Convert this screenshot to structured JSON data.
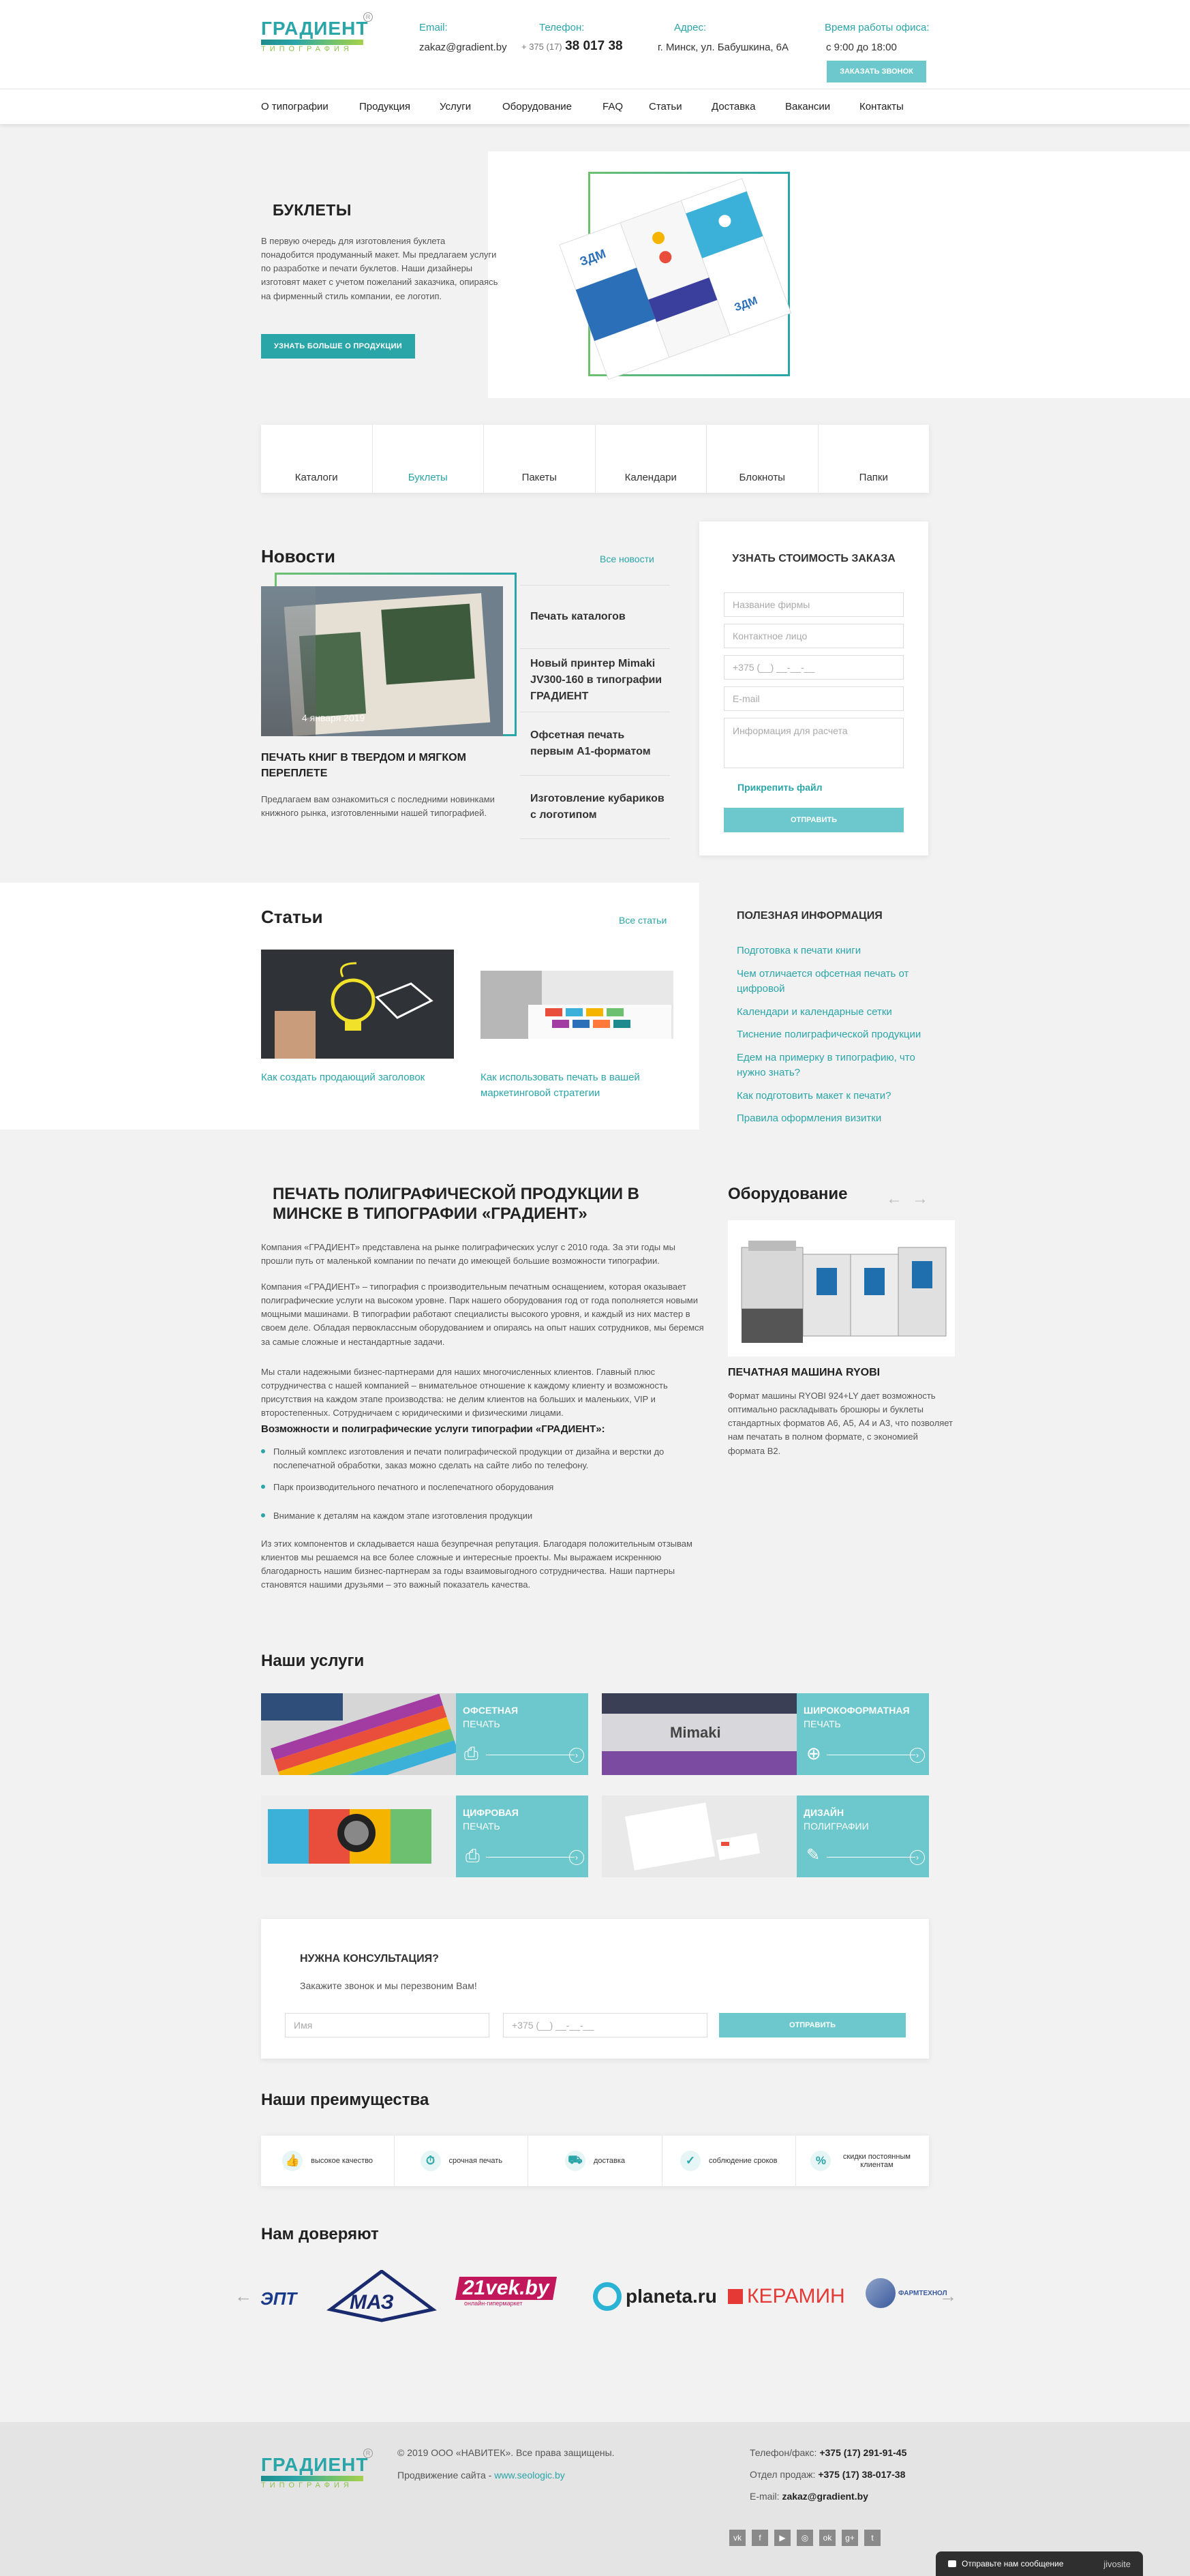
{
  "header": {
    "logo_text": "ГРАДИЕНТ",
    "logo_sub": "ТИПОГРАФИЯ",
    "email_label": "Email:",
    "email": "zakaz@gradient.by",
    "phone_label": "Телефон:",
    "phone_prefix": "+ 375 (17)",
    "phone_number": "38 017 38",
    "address_label": "Адрес:",
    "address": "г. Минск, ул. Бабушкина, 6А",
    "hours_label": "Время работы офиса:",
    "hours": "с 9:00 до 18:00",
    "callback_button": "ЗАКАЗАТЬ ЗВОНОК"
  },
  "nav": {
    "items": [
      "О типографии",
      "Продукция",
      "Услуги",
      "Оборудование",
      "FAQ",
      "Статьи",
      "Доставка",
      "Вакансии",
      "Контакты"
    ]
  },
  "hero": {
    "title": "БУКЛЕТЫ",
    "text": "В первую очередь для изготовления буклета понадобится продуманный макет. Мы предлагаем услуги по разработке и печати буклетов. Наши дизайнеры изготовят макет с учетом пожеланий заказчика, опираясь на фирменный стиль компании, ее логотип.",
    "button": "УЗНАТЬ БОЛЬШЕ О ПРОДУКЦИИ"
  },
  "product_tabs": [
    "Каталоги",
    "Буклеты",
    "Пакеты",
    "Календари",
    "Блокноты",
    "Папки"
  ],
  "product_tab_active": "Буклеты",
  "news": {
    "title": "Новости",
    "all_link": "Все новости",
    "featured_date": "4 января 2019",
    "featured_title": "ПЕЧАТЬ КНИГ В ТВЕРДОМ И МЯГКОМ ПЕРЕПЛЕТЕ",
    "featured_text": "Предлагаем вам ознакомиться с последними новинками книжного рынка, изготовленными нашей типографией.",
    "items": [
      "Печать каталогов",
      "Новый принтер Mimaki JV300-160 в типографии ГРАДИЕНТ",
      "Офсетная печать первым А1-форматом",
      "Изготовление кубариков с логотипом"
    ]
  },
  "quote_form": {
    "title": "УЗНАТЬ СТОИМОСТЬ ЗАКАЗА",
    "company_placeholder": "Название фирмы",
    "contact_placeholder": "Контактное лицо",
    "phone_placeholder": "+375 (__) __-__-__",
    "email_placeholder": "E-mail",
    "info_placeholder": "Информация для расчета",
    "attach_label": "Прикрепить файл",
    "submit": "ОТПРАВИТЬ"
  },
  "articles": {
    "title": "Статьи",
    "all_link": "Все статьи",
    "items": [
      "Как создать продающий заголовок",
      "Как использовать печать в вашей маркетинговой стратегии"
    ]
  },
  "useful_info": {
    "title": "ПОЛЕЗНАЯ ИНФОРМАЦИЯ",
    "links": [
      "Подготовка к печати книги",
      "Чем отличается офсетная печать от цифровой",
      "Календари и календарные сетки",
      "Тиснение полиграфической продукции",
      "Едем на примерку в типографию, что нужно знать?",
      "Как подготовить макет к печати?",
      "Правила оформления визитки"
    ]
  },
  "about": {
    "title": "ПЕЧАТЬ ПОЛИГРАФИЧЕСКОЙ ПРОДУКЦИИ В МИНСКЕ В ТИПОГРАФИИ «ГРАДИЕНТ»",
    "p1": "Компания «ГРАДИЕНТ» представлена на рынке полиграфических услуг с 2010 года. За эти годы мы прошли путь от маленькой компании по печати до имеющей большие возможности типографии.",
    "p2": "Компания «ГРАДИЕНТ» – типография с производительным печатным оснащением, которая оказывает полиграфические услуги на высоком уровне. Парк нашего оборудования год от года пополняется новыми мощными машинами. В типографии работают специалисты высокого уровня, и каждый из них мастер в своем деле. Обладая первоклассным оборудованием и опираясь на опыт наших сотрудников, мы беремся за самые сложные и нестандартные задачи.",
    "p3": "Мы стали надежными бизнес-партнерами для наших многочисленных клиентов. Главный плюс сотрудничества с нашей компанией – внимательное отношение к каждому клиенту и возможность присутствия на каждом этапе производства: не делим клиентов на больших и маленьких, VIP и второстепенных. Сотрудничаем с юридическими и физическими лицами.",
    "subtitle": "Возможности и полиграфические услуги типографии «ГРАДИЕНТ»:",
    "bullets": [
      "Полный комплекс изготовления и печати полиграфической продукции от дизайна и верстки до послепечатной обработки, заказ можно сделать на сайте либо по телефону.",
      "Парк производительного печатного и послепечатного оборудования",
      "Внимание к деталям на каждом этапе изготовления продукции"
    ],
    "p4": "Из этих компонентов и складывается наша безупречная репутация. Благодаря положительным отзывам клиентов мы решаемся на все более сложные и интересные проекты. Мы выражаем искреннюю благодарность нашим бизнес-партнерам за годы взаимовыгодного сотрудничества. Наши партнеры становятся нашими друзьями – это важный показатель качества."
  },
  "equipment": {
    "title": "Оборудование",
    "machine_title": "ПЕЧАТНАЯ МАШИНА RYOBI",
    "machine_text": "Формат машины RYOBI 924+LY дает возможность оптимально раскладывать брошюры и буклеты стандартных форматов А6, А5, А4 и А3, что позволяет нам печатать в полном формате, с экономией формата В2."
  },
  "services": {
    "title": "Наши услуги",
    "items": [
      {
        "line1": "ОФСЕТНАЯ",
        "line2": "ПЕЧАТЬ"
      },
      {
        "line1": "ШИРОКОФОРМАТНАЯ",
        "line2": "ПЕЧАТЬ"
      },
      {
        "line1": "ЦИФРОВАЯ",
        "line2": "ПЕЧАТЬ"
      },
      {
        "line1": "ДИЗАЙН",
        "line2": "ПОЛИГРАФИИ"
      }
    ]
  },
  "consult": {
    "title": "НУЖНА КОНСУЛЬТАЦИЯ?",
    "subtitle": "Закажите звонок и мы перезвоним Вам!",
    "name_placeholder": "Имя",
    "phone_placeholder": "+375 (__) __-__-__",
    "submit": "ОТПРАВИТЬ"
  },
  "advantages": {
    "title": "Наши преимущества",
    "items": [
      "высокое качество",
      "срочная печать",
      "доставка",
      "соблюдение сроков",
      "скидки постоянным клиентам"
    ]
  },
  "trust": {
    "title": "Нам доверяют",
    "logos": [
      "ЭПТ",
      "МАЗ",
      "21vek.by",
      "planeta.ru",
      "КЕРАМИН",
      "ФАРМТЕХНОЛ"
    ],
    "vek_sub": "онлайн-гипермаркет"
  },
  "footer": {
    "logo_text": "ГРАДИЕНТ",
    "logo_sub": "ТИПОГРАФИЯ",
    "copyright": "© 2019 ООО «НАВИТЕК». Все права защищены.",
    "promo_label": "Продвижение сайта -",
    "promo_link": "www.seologic.by",
    "phonefax_label": "Телефон/факс:",
    "phonefax": "+375 (17) 291-91-45",
    "sales_label": "Отдел продаж:",
    "sales": "+375 (17) 38-017-38",
    "email_label": "E-mail:",
    "email": "zakaz@gradient.by",
    "chat_label": "Отправьте нам сообщение",
    "chat_brand": "jivosite"
  }
}
